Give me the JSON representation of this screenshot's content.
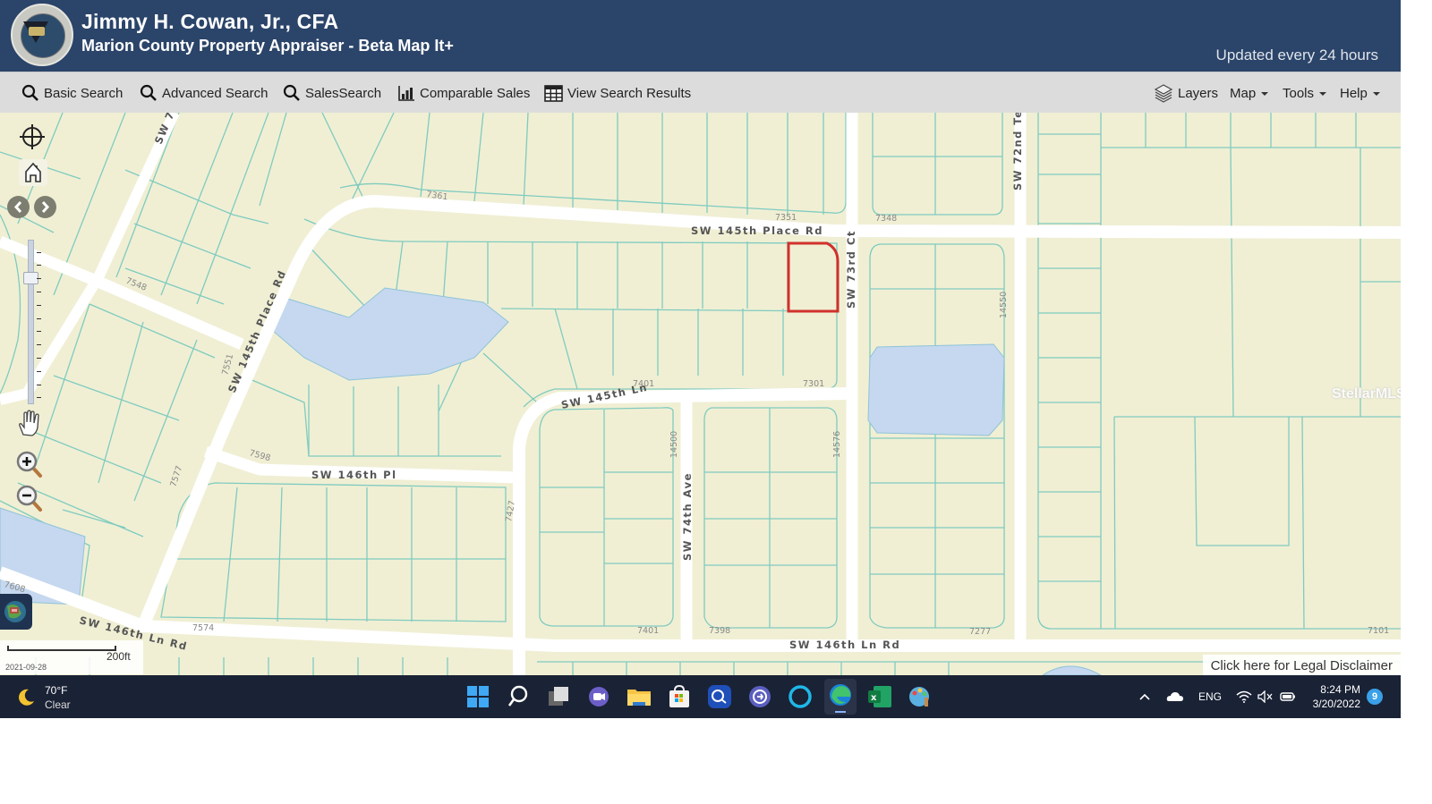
{
  "header": {
    "title": "Jimmy H. Cowan, Jr., CFA",
    "subtitle": "Marion County Property Appraiser - Beta Map It+",
    "updated": "Updated every 24 hours",
    "logo_icon": "property-appraiser-seal"
  },
  "toolbar": {
    "left": [
      {
        "label": "Basic Search",
        "icon": "search-icon"
      },
      {
        "label": "Advanced Search",
        "icon": "search-icon"
      },
      {
        "label": "SalesSearch",
        "icon": "search-icon"
      },
      {
        "label": "Comparable Sales",
        "icon": "bar-chart-icon"
      },
      {
        "label": "View Search Results",
        "icon": "table-icon"
      }
    ],
    "right": [
      {
        "label": "Layers",
        "icon": "layers-icon"
      },
      {
        "label": "Map",
        "icon": "caret-down-icon"
      },
      {
        "label": "Tools",
        "icon": "caret-down-icon"
      },
      {
        "label": "Help",
        "icon": "caret-down-icon"
      }
    ]
  },
  "map": {
    "streets": {
      "sw145_place_rd_top": "SW 145th Place Rd",
      "sw145_place_rd_diag": "SW 145th Place Rd",
      "sw73rd_ct": "SW 73rd Ct",
      "sw72nd_ter": "SW 72nd Te",
      "sw7x_top": "SW 7",
      "sw145_ln": "SW 145th Ln",
      "sw146_pl": "SW 146th Pl",
      "sw74_ave": "SW 74th Ave",
      "sw146_ln_rd_left": "SW 146th Ln Rd",
      "sw146_ln_rd_right": "SW 146th Ln Rd"
    },
    "addresses": {
      "a7361": "7361",
      "a7351": "7351",
      "a7348": "7348",
      "a7548": "7548",
      "a7551": "7551",
      "a7401_top": "7401",
      "a7301": "7301",
      "a14500_a": "14500",
      "a14576": "14576",
      "a14550": "14550",
      "a7598": "7598",
      "a7577": "7577",
      "a7427": "7427",
      "a7608": "7608",
      "a7574": "7574",
      "a7401_bot": "7401",
      "a7398": "7398",
      "a7277": "7277",
      "a7101": "7101"
    },
    "selected_parcel_color": "#d0312d",
    "water_color": "#c5d8ef",
    "parcel_line_color": "#7fcbbf",
    "scale_label": "200ft",
    "date_label": "2021-09-28",
    "disclaimer": "Click here for Legal Disclaimer",
    "watermark": "StellarMLS",
    "controls": [
      "locate-icon",
      "home-icon",
      "back-icon",
      "forward-icon",
      "zoom-slider",
      "pan-hand-icon",
      "zoom-in-icon",
      "zoom-out-icon",
      "basemap-icon"
    ]
  },
  "taskbar": {
    "weather_temp": "70°F",
    "weather_desc": "Clear",
    "apps": [
      "windows-start",
      "search",
      "task-view",
      "teams-chat",
      "file-explorer",
      "microsoft-store",
      "app-search",
      "app-circle",
      "alexa",
      "edge",
      "excel",
      "paint"
    ],
    "tray_lang": "ENG",
    "time": "8:24 PM",
    "date": "3/20/2022",
    "notifications": "9"
  }
}
